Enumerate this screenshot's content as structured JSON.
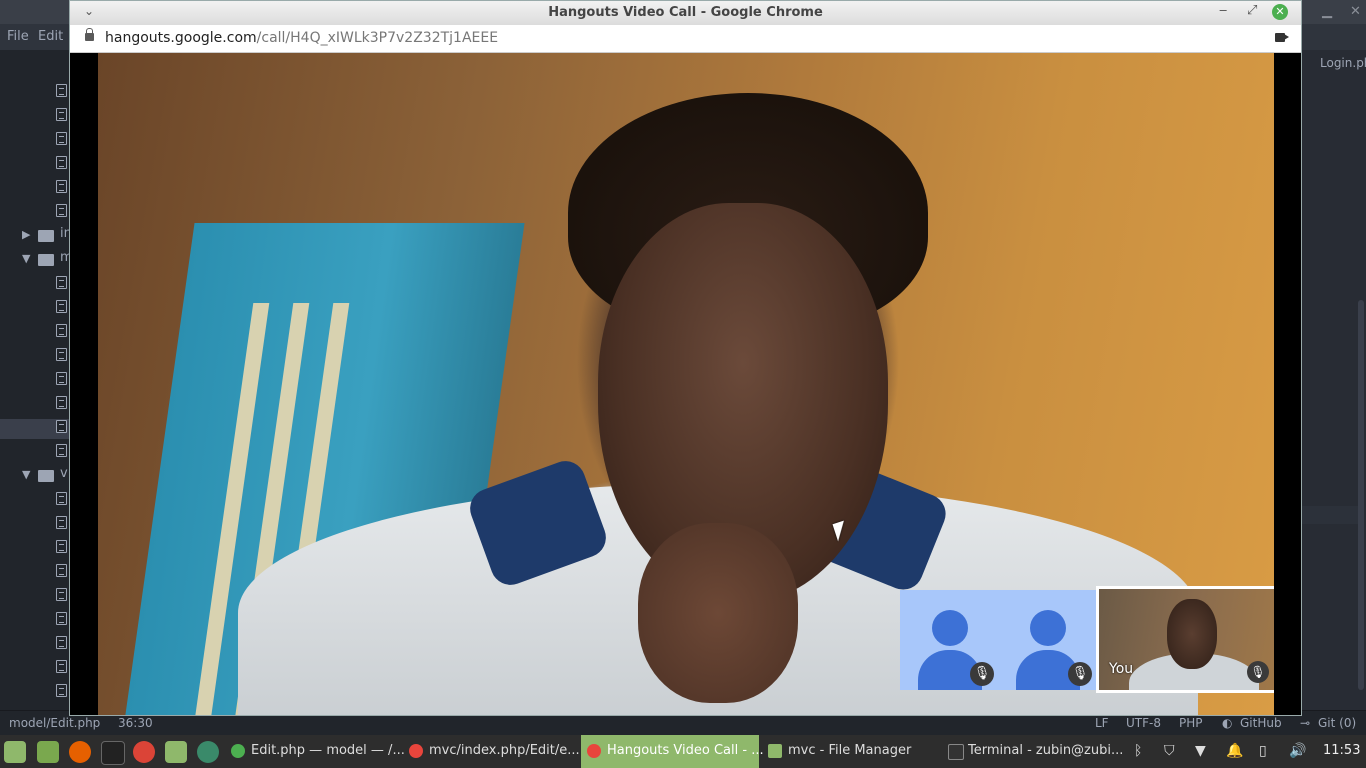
{
  "atom": {
    "menu": {
      "file": "File",
      "edit": "Edit"
    },
    "tree_labels": {
      "folder1": "in",
      "folder2": "m",
      "folder3": "v"
    },
    "right_tab": "Login.ph"
  },
  "statusbar": {
    "file_path": "model/Edit.php",
    "cursor_pos": "36:30",
    "line_ending": "LF",
    "encoding": "UTF-8",
    "grammar": "PHP",
    "github": "GitHub",
    "git": "Git (0)"
  },
  "chrome": {
    "title": "Hangouts Video Call - Google Chrome",
    "url_host": "hangouts.google.com",
    "url_path": "/call/H4Q_xIWLk3P7v2Z32Tj1AEEE"
  },
  "call": {
    "self_label": "You"
  },
  "taskbar": {
    "tasks": [
      {
        "label": "Edit.php — model — /...",
        "color": "#4caf50"
      },
      {
        "label": "mvc/index.php/Edit/e...",
        "color": "#e8453c"
      },
      {
        "label": "Hangouts Video Call - ...",
        "color": "#e8453c"
      },
      {
        "label": "mvc - File Manager",
        "color": "#8fb86b"
      },
      {
        "label": "Terminal - zubin@zubi...",
        "color": "#333333"
      }
    ],
    "clock": "11:53"
  },
  "colors": {
    "accent": "#8fb86b",
    "hangouts_blue": "#3d71d6",
    "tile_bg": "#a8c7fa"
  }
}
